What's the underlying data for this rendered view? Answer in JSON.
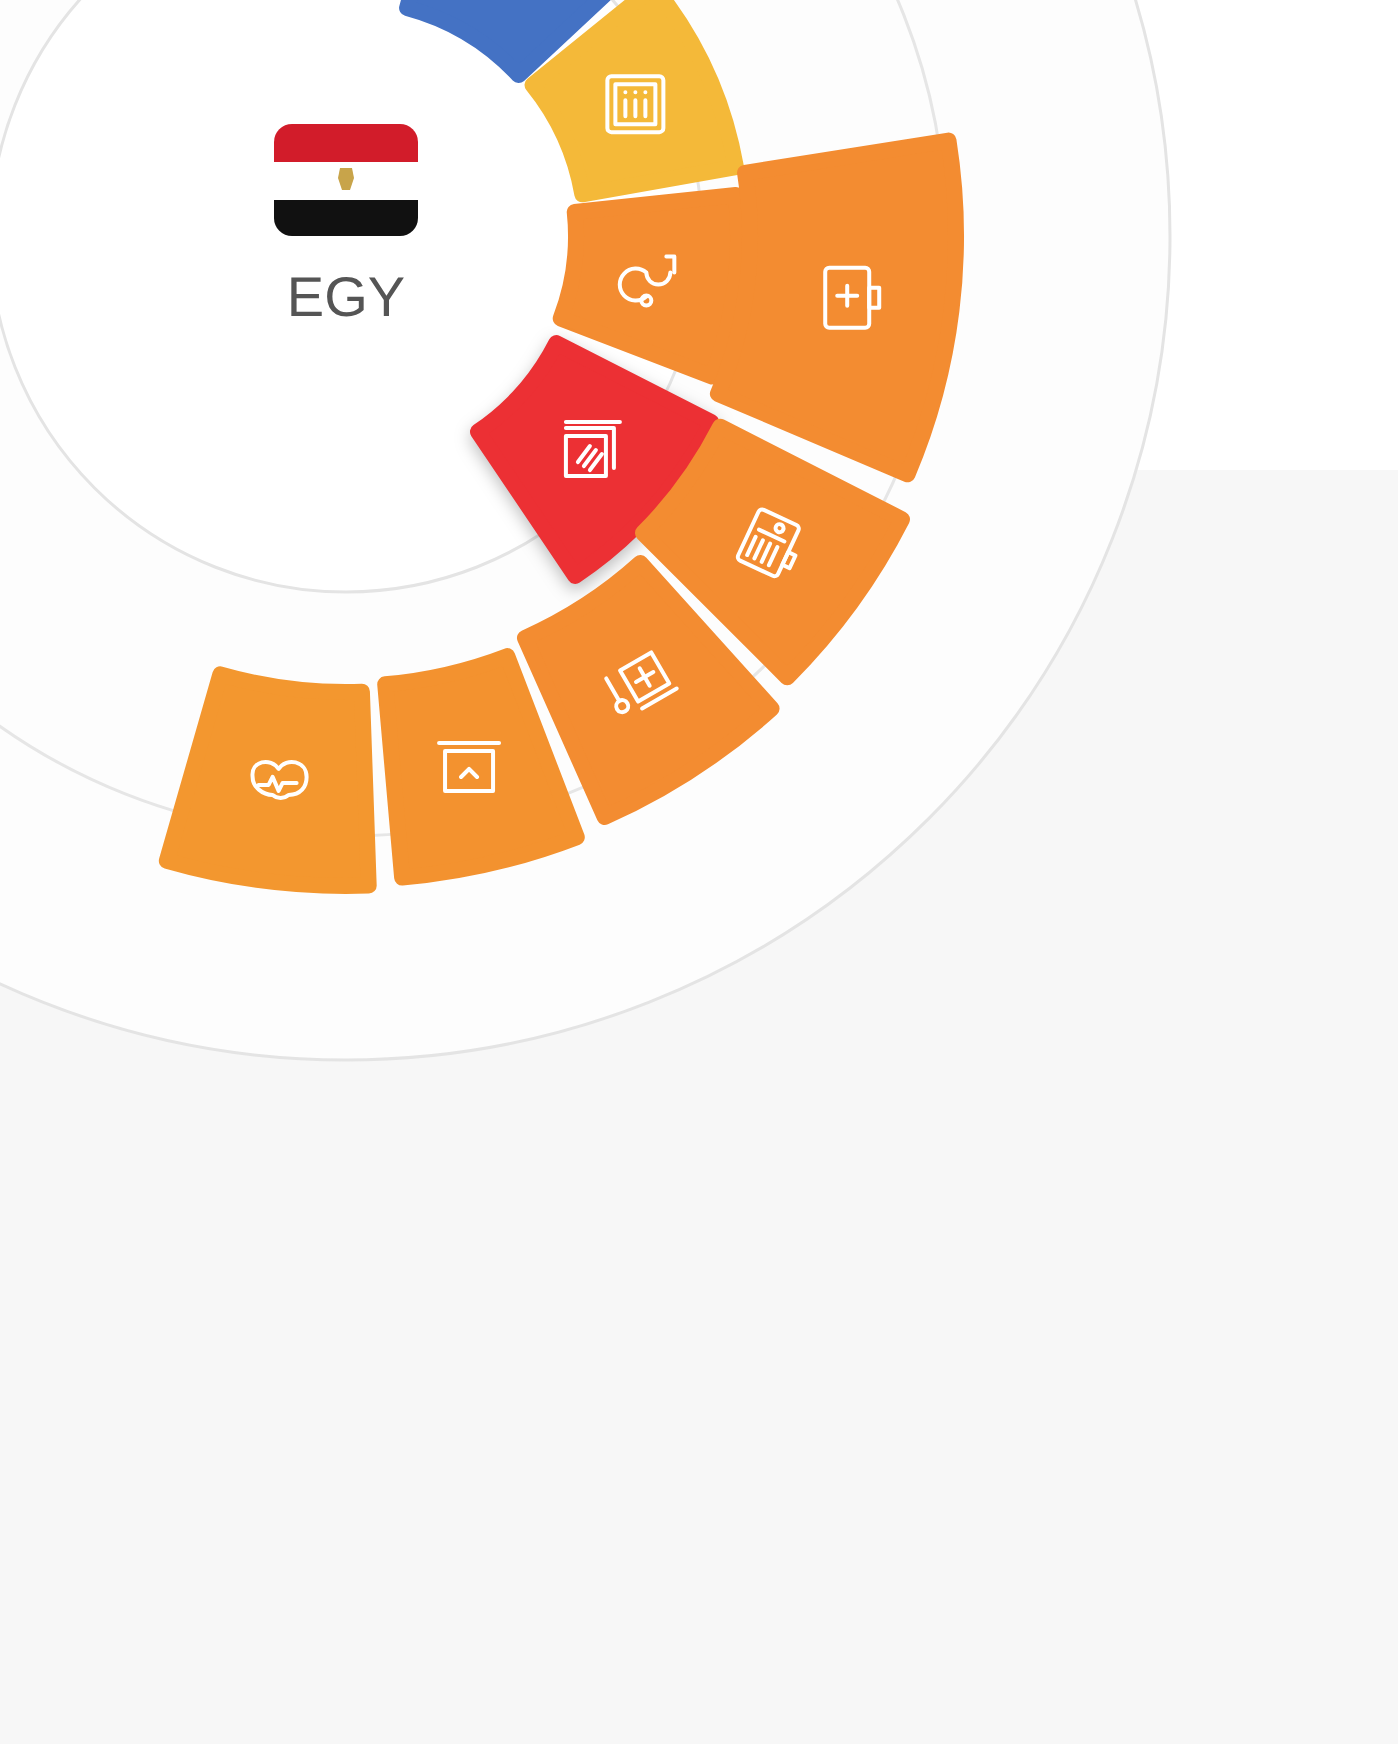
{
  "country": {
    "code": "EGY"
  },
  "tiles": [
    {
      "color": "#4472c4",
      "selected": false
    },
    {
      "color": "#f4b939",
      "selected": false
    },
    {
      "color": "#f38c31",
      "selected": false
    },
    {
      "color": "#ec3034",
      "selected": true
    },
    {
      "color": "#f38c31",
      "selected": false
    },
    {
      "color": "#f38c31",
      "selected": false
    },
    {
      "color": "#f38c31",
      "selected": false
    },
    {
      "color": "#f3922f",
      "selected": false
    },
    {
      "color": "#f3972f",
      "selected": false
    }
  ]
}
